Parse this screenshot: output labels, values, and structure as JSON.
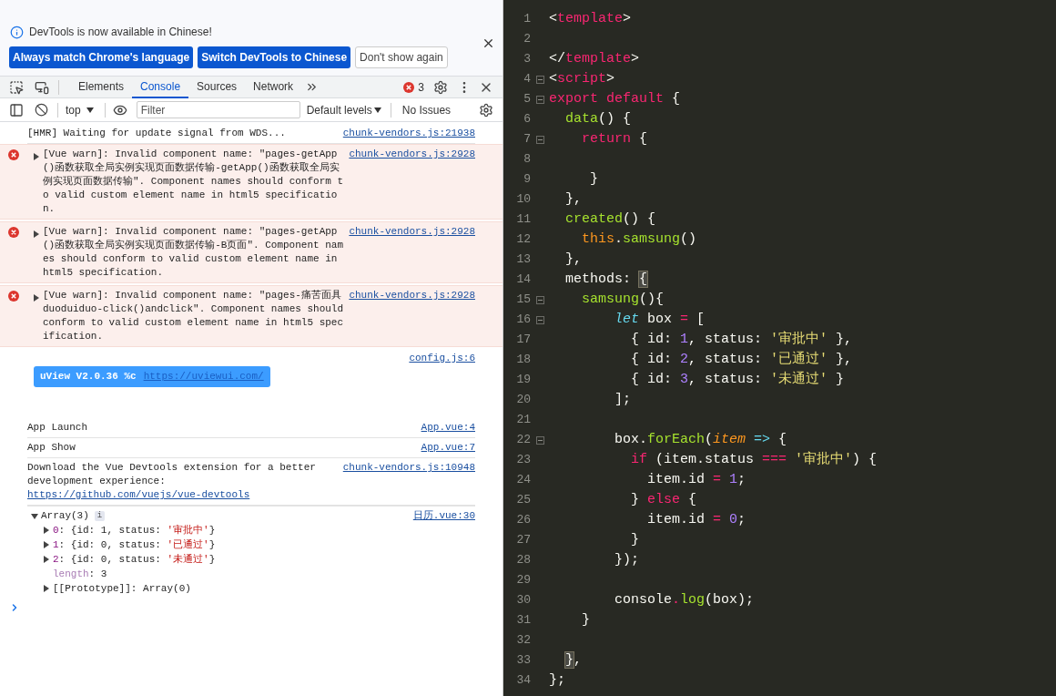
{
  "banner": {
    "message": "DevTools is now available in Chinese!",
    "buttons": [
      {
        "label": "Always match Chrome's language",
        "kind": "primary"
      },
      {
        "label": "Switch DevTools to Chinese",
        "kind": "primary"
      },
      {
        "label": "Don't show again",
        "kind": "secondary"
      }
    ]
  },
  "tabs": [
    {
      "label": "Elements",
      "selected": false
    },
    {
      "label": "Console",
      "selected": true
    },
    {
      "label": "Sources",
      "selected": false
    },
    {
      "label": "Network",
      "selected": false
    }
  ],
  "error_count": "3",
  "console_bar": {
    "context": "top",
    "filter_placeholder": "Filter",
    "levels": "Default levels",
    "issues": "No Issues"
  },
  "messages": [
    {
      "kind": "log",
      "text": "[HMR] Waiting for update signal from WDS...",
      "source": "chunk-vendors.js:21938"
    },
    {
      "kind": "error",
      "text": "[Vue warn]: Invalid component name: \"pages-getApp()函数获取全局实例实现页面数据传输-getApp()函数获取全局实例实现页面数据传输\". Component names should conform to valid custom element name in html5 specification.",
      "source": "chunk-vendors.js:2928"
    },
    {
      "kind": "error",
      "text": "[Vue warn]: Invalid component name: \"pages-getApp()函数获取全局实例实现页面数据传输-B页面\". Component names should conform to valid custom element name in html5 specification.",
      "source": "chunk-vendors.js:2928"
    },
    {
      "kind": "error",
      "text": "[Vue warn]: Invalid component name: \"pages-痛苦面具duoduiduo-click()andclick\". Component names should conform to valid custom element name in html5 specification.",
      "source": "chunk-vendors.js:2928"
    },
    {
      "kind": "badge",
      "text": "uView V2.0.36 %c",
      "link": "https://uviewui.com/",
      "source": "config.js:6"
    },
    {
      "kind": "log",
      "text": "App Launch",
      "source": "App.vue:4"
    },
    {
      "kind": "log",
      "text": "App Show",
      "source": "App.vue:7"
    },
    {
      "kind": "log",
      "text": "Download the Vue Devtools extension for a better development experience:",
      "link": "https://github.com/vuejs/vue-devtools",
      "source": "chunk-vendors.js:10948"
    },
    {
      "kind": "object",
      "summary": "Array(3)",
      "info": "i",
      "expanded": true,
      "source": "日历.vue:30",
      "entries": [
        {
          "kind": "item",
          "key": "0",
          "before": ": {id: 1, status: ",
          "value": "'审批中'",
          "after": "}"
        },
        {
          "kind": "item",
          "key": "1",
          "before": ": {id: 0, status: ",
          "value": "'已通过'",
          "after": "}"
        },
        {
          "kind": "item",
          "key": "2",
          "before": ": {id: 0, status: ",
          "value": "'未通过'",
          "after": "}"
        },
        {
          "kind": "length",
          "key": "length",
          "before": ": 3"
        },
        {
          "kind": "proto",
          "key": "[[Prototype]]",
          "before": ": Array(0)"
        }
      ]
    }
  ],
  "editor": {
    "lines": [
      {
        "n": "1",
        "tokens": [
          {
            "text": "<",
            "kind": "plain"
          },
          {
            "text": "template",
            "kind": "tag"
          },
          {
            "text": ">",
            "kind": "plain"
          }
        ]
      },
      {
        "n": "2"
      },
      {
        "n": "3",
        "tokens": [
          {
            "text": "</",
            "kind": "plain"
          },
          {
            "text": "template",
            "kind": "tag"
          },
          {
            "text": ">",
            "kind": "plain"
          }
        ]
      },
      {
        "n": "4",
        "fold": true,
        "tokens": [
          {
            "text": "<",
            "kind": "plain"
          },
          {
            "text": "script",
            "kind": "tag"
          },
          {
            "text": ">",
            "kind": "plain"
          }
        ]
      },
      {
        "n": "5",
        "fold": true,
        "tokens": [
          {
            "text": "export default",
            "kind": "keyword"
          },
          {
            "text": " {",
            "kind": "plain"
          }
        ]
      },
      {
        "n": "6",
        "tokens": [
          {
            "text": "  data",
            "kind": "function"
          },
          {
            "text": "() {",
            "kind": "plain"
          }
        ]
      },
      {
        "n": "7",
        "fold": true,
        "tokens": [
          {
            "text": "    return",
            "kind": "keyword"
          },
          {
            "text": " {",
            "kind": "plain"
          }
        ]
      },
      {
        "n": "8"
      },
      {
        "n": "9",
        "tokens": [
          {
            "text": "     }",
            "kind": "plain"
          }
        ]
      },
      {
        "n": "10",
        "tokens": [
          {
            "text": "  },",
            "kind": "plain"
          }
        ]
      },
      {
        "n": "11",
        "tokens": [
          {
            "text": "  created",
            "kind": "function"
          },
          {
            "text": "() {",
            "kind": "plain"
          }
        ]
      },
      {
        "n": "12",
        "tokens": [
          {
            "text": "    this",
            "kind": "this"
          },
          {
            "text": ".",
            "kind": "plain"
          },
          {
            "text": "samsung",
            "kind": "function"
          },
          {
            "text": "()",
            "kind": "plain"
          }
        ]
      },
      {
        "n": "13",
        "tokens": [
          {
            "text": "  },",
            "kind": "plain"
          }
        ]
      },
      {
        "n": "14",
        "tokens": [
          {
            "text": "  methods: ",
            "kind": "plain"
          },
          {
            "text": "{",
            "kind": "match"
          }
        ]
      },
      {
        "n": "15",
        "fold": true,
        "tokens": [
          {
            "text": "    samsung",
            "kind": "function"
          },
          {
            "text": "(){",
            "kind": "plain"
          }
        ]
      },
      {
        "n": "16",
        "fold": true,
        "tokens": [
          {
            "text": "        let",
            "kind": "storage"
          },
          {
            "text": " box ",
            "kind": "plain"
          },
          {
            "text": "=",
            "kind": "operator"
          },
          {
            "text": " [",
            "kind": "plain"
          }
        ]
      },
      {
        "n": "17",
        "tokens": [
          {
            "text": "          { id: ",
            "kind": "plain"
          },
          {
            "text": "1",
            "kind": "number"
          },
          {
            "text": ", status: ",
            "kind": "plain"
          },
          {
            "text": "'审批中'",
            "kind": "string"
          },
          {
            "text": " },",
            "kind": "plain"
          }
        ]
      },
      {
        "n": "18",
        "tokens": [
          {
            "text": "          { id: ",
            "kind": "plain"
          },
          {
            "text": "2",
            "kind": "number"
          },
          {
            "text": ", status: ",
            "kind": "plain"
          },
          {
            "text": "'已通过'",
            "kind": "string"
          },
          {
            "text": " },",
            "kind": "plain"
          }
        ]
      },
      {
        "n": "19",
        "tokens": [
          {
            "text": "          { id: ",
            "kind": "plain"
          },
          {
            "text": "3",
            "kind": "number"
          },
          {
            "text": ", status: ",
            "kind": "plain"
          },
          {
            "text": "'未通过'",
            "kind": "string"
          },
          {
            "text": " }",
            "kind": "plain"
          }
        ]
      },
      {
        "n": "20",
        "tokens": [
          {
            "text": "        ];",
            "kind": "plain"
          }
        ]
      },
      {
        "n": "21"
      },
      {
        "n": "22",
        "fold": true,
        "tokens": [
          {
            "text": "        box.",
            "kind": "plain"
          },
          {
            "text": "forEach",
            "kind": "function"
          },
          {
            "text": "(",
            "kind": "plain"
          },
          {
            "text": "item",
            "kind": "parameter"
          },
          {
            "text": " =>",
            "kind": "arrow"
          },
          {
            "text": " {",
            "kind": "plain"
          }
        ]
      },
      {
        "n": "23",
        "tokens": [
          {
            "text": "          if",
            "kind": "keyword"
          },
          {
            "text": " (item.status ",
            "kind": "plain"
          },
          {
            "text": "===",
            "kind": "operator"
          },
          {
            "text": " '审批中'",
            "kind": "string"
          },
          {
            "text": ") {",
            "kind": "plain"
          }
        ]
      },
      {
        "n": "24",
        "tokens": [
          {
            "text": "            item.id ",
            "kind": "plain"
          },
          {
            "text": "=",
            "kind": "operator"
          },
          {
            "text": " 1",
            "kind": "number"
          },
          {
            "text": ";",
            "kind": "plain"
          }
        ]
      },
      {
        "n": "25",
        "tokens": [
          {
            "text": "          } ",
            "kind": "plain"
          },
          {
            "text": "else",
            "kind": "keyword"
          },
          {
            "text": " {",
            "kind": "plain"
          }
        ]
      },
      {
        "n": "26",
        "tokens": [
          {
            "text": "            item.id ",
            "kind": "plain"
          },
          {
            "text": "=",
            "kind": "operator"
          },
          {
            "text": " 0",
            "kind": "number"
          },
          {
            "text": ";",
            "kind": "plain"
          }
        ]
      },
      {
        "n": "27",
        "tokens": [
          {
            "text": "          }",
            "kind": "plain"
          }
        ]
      },
      {
        "n": "28",
        "tokens": [
          {
            "text": "        });",
            "kind": "plain"
          }
        ]
      },
      {
        "n": "29"
      },
      {
        "n": "30",
        "tokens": [
          {
            "text": "        console",
            "kind": "plain"
          },
          {
            "text": ".",
            "kind": "operator"
          },
          {
            "text": "log",
            "kind": "function"
          },
          {
            "text": "(box);",
            "kind": "plain"
          }
        ]
      },
      {
        "n": "31",
        "tokens": [
          {
            "text": "    }",
            "kind": "plain"
          }
        ]
      },
      {
        "n": "32"
      },
      {
        "n": "33",
        "tokens": [
          {
            "text": "  }",
            "kind": "match"
          },
          {
            "text": ",",
            "kind": "plain"
          }
        ]
      },
      {
        "n": "34",
        "tokens": [
          {
            "text": "};",
            "kind": "plain"
          }
        ]
      }
    ]
  }
}
